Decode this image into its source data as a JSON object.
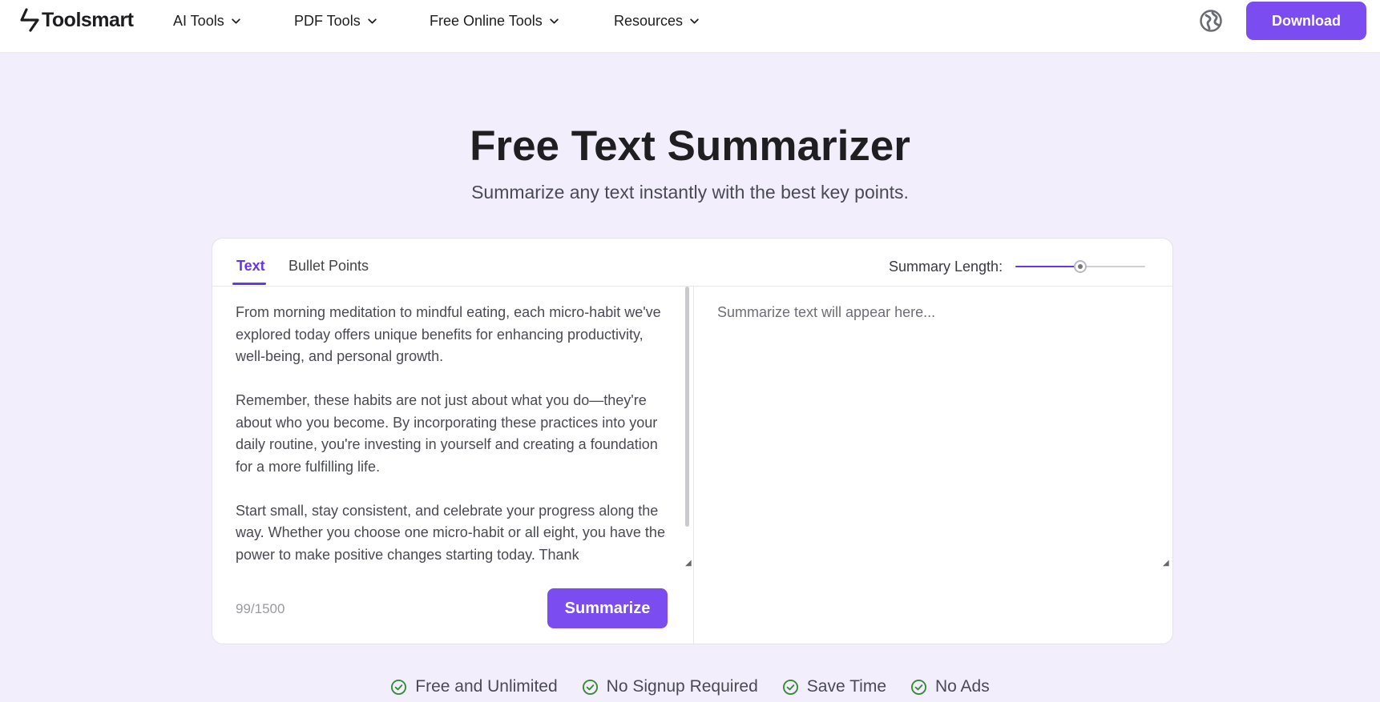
{
  "header": {
    "logo_text": "Toolsmart",
    "nav": [
      {
        "label": "AI Tools"
      },
      {
        "label": "PDF Tools"
      },
      {
        "label": "Free Online Tools"
      },
      {
        "label": "Resources"
      }
    ],
    "download_label": "Download"
  },
  "hero": {
    "title": "Free Text Summarizer",
    "subtitle": "Summarize any text instantly with the best key points."
  },
  "tool": {
    "tabs": [
      {
        "label": "Text",
        "active": true
      },
      {
        "label": "Bullet Points",
        "active": false
      }
    ],
    "summary_length_label": "Summary Length:",
    "summary_length_fraction": 0.5,
    "input_text": "From morning meditation to mindful eating, each micro-habit we've explored today offers unique benefits for enhancing productivity, well-being, and personal growth.\n\nRemember, these habits are not just about what you do—they're about who you become. By incorporating these practices into your daily routine, you're investing in yourself and creating a foundation for a more fulfilling life.\n\nStart small, stay consistent, and celebrate your progress along the way. Whether you choose one micro-habit or all eight, you have the power to make positive changes starting today. Thank",
    "char_count": "99/1500",
    "summarize_label": "Summarize",
    "output_placeholder": "Summarize text will appear here..."
  },
  "features": [
    {
      "label": "Free and Unlimited",
      "icon": "check-circle-icon"
    },
    {
      "label": "No Signup Required",
      "icon": "check-circle-icon"
    },
    {
      "label": "Save Time",
      "icon": "check-circle-icon"
    },
    {
      "label": "No Ads",
      "icon": "check-circle-icon"
    }
  ],
  "colors": {
    "accent": "#7b4cf0",
    "tab_active": "#6a35e8",
    "page_background": "#f2eefc",
    "check_green": "#3a8a3a"
  }
}
